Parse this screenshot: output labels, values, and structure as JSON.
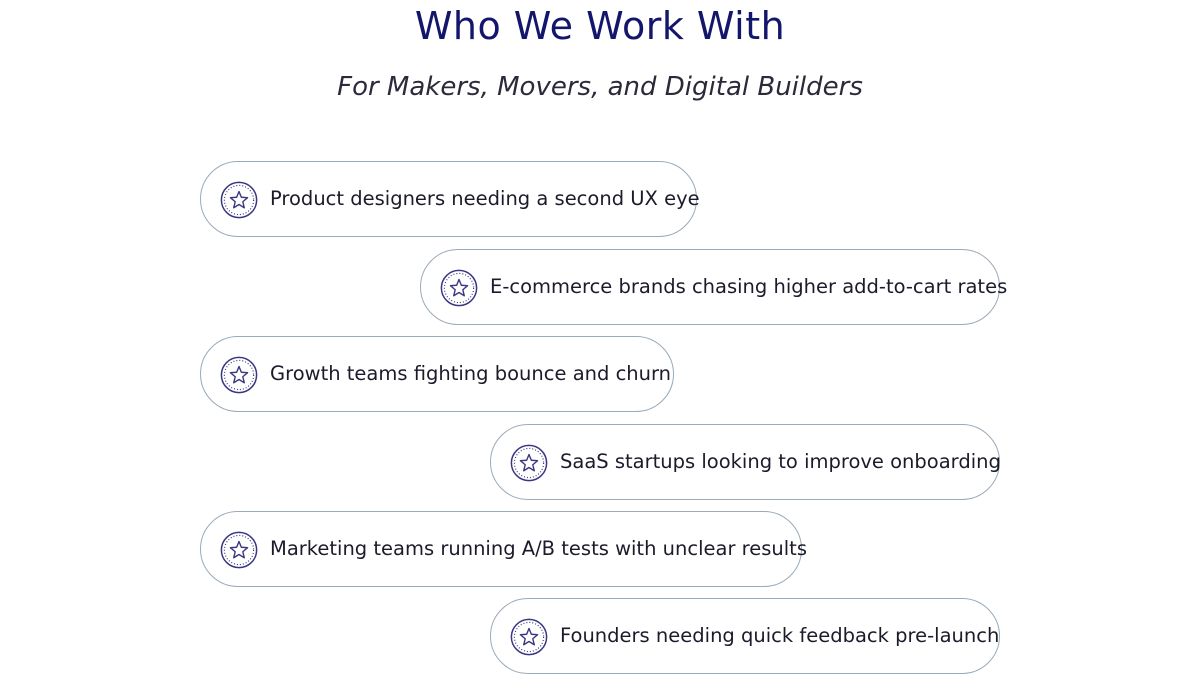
{
  "header": {
    "title": "Who We Work With",
    "subtitle": "For Makers, Movers, and Digital Builders"
  },
  "audience": {
    "icon": "star-badge-icon",
    "items": [
      {
        "label": "Product designers needing a second UX eye"
      },
      {
        "label": "E-commerce brands chasing higher add-to-cart rates"
      },
      {
        "label": "Growth teams fighting bounce and churn"
      },
      {
        "label": "SaaS startups looking to improve onboarding"
      },
      {
        "label": "Marketing teams running A/B tests with unclear results"
      },
      {
        "label": "Founders needing quick feedback pre-launch"
      }
    ]
  },
  "colors": {
    "title": "#14166b",
    "icon": "#3a3782",
    "pill_border": "#9aaab8",
    "text": "#1b1b2b"
  }
}
